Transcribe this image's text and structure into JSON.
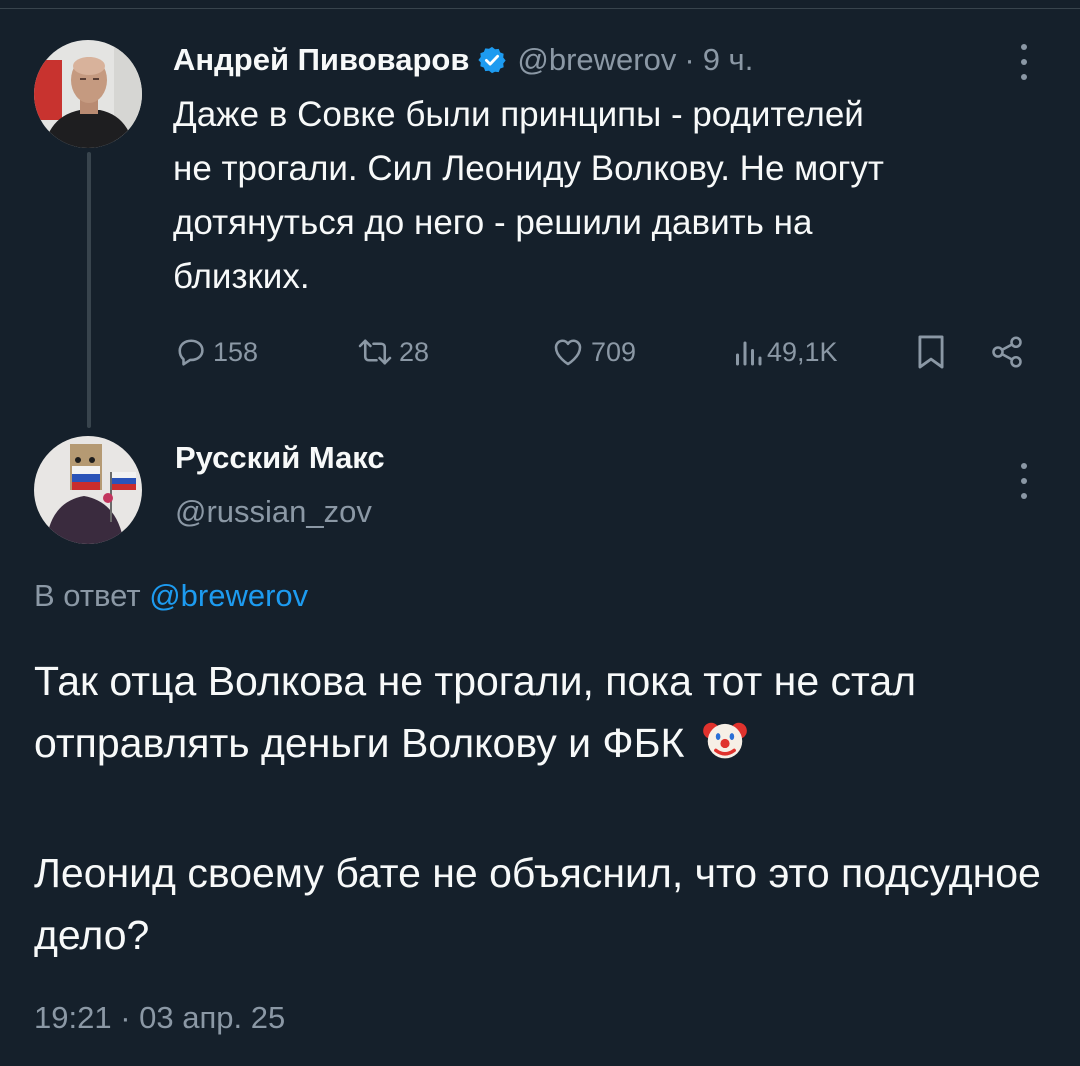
{
  "parent_tweet": {
    "author_name": "Андрей Пивоваров",
    "verified_icon": "verified-badge-icon",
    "handle": "@brewerov",
    "separator": "·",
    "time_ago": "9 ч.",
    "text": "Даже в Совке были принципы - родителей\nне трогали. Сил Леониду Волкову. Не могут\nдотянуться до него - решили давить на\nблизких.",
    "replies": "158",
    "retweets": "28",
    "likes": "709",
    "views": "49,1K"
  },
  "reply_tweet": {
    "author_name": "Русский Макс",
    "handle": "@russian_zov",
    "reply_prefix": "В ответ",
    "reply_handle": "@brewerov",
    "paragraph1": "Так отца Волкова не трогали, пока тот не стал отправлять деньги Волкову и ФБК",
    "emoji_icon": "clown-face-icon",
    "paragraph2": "Леонид своему бате не объяснил, что это подсудное дело?",
    "timestamp": "19:21 · 03 апр. 25"
  },
  "colors": {
    "background": "#15202b",
    "text": "#f7f9f9",
    "muted": "#8b98a5",
    "accent": "#1d9bf0",
    "divider": "#38444d"
  }
}
